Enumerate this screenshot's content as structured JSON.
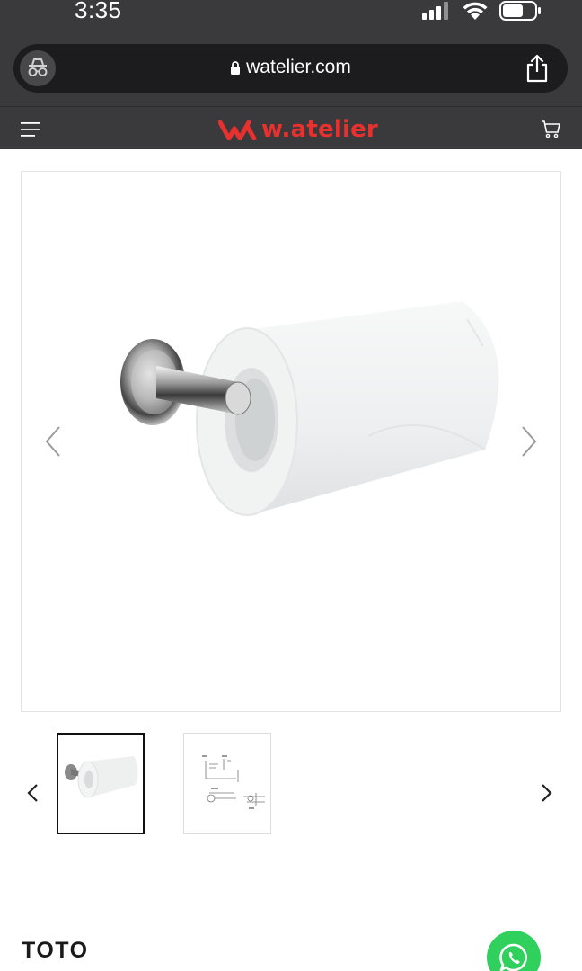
{
  "status_bar": {
    "time": "3:35"
  },
  "browser": {
    "url": "watelier.com",
    "incognito_icon": "incognito-icon",
    "lock_icon": "lock-icon",
    "share_icon": "share-icon"
  },
  "site_header": {
    "menu_icon": "hamburger-menu-icon",
    "logo_text": "w.atelier",
    "cart_icon": "cart-icon",
    "brand_color": "#e8312f",
    "header_bg": "#3a3a3c"
  },
  "gallery": {
    "main_image_alt": "toilet paper holder with roll",
    "prev_icon": "chevron-left-icon",
    "next_icon": "chevron-right-icon",
    "thumbnails": [
      {
        "name": "product-photo",
        "selected": true
      },
      {
        "name": "technical-drawing",
        "selected": false
      }
    ]
  },
  "product": {
    "brand": "TOTO"
  },
  "whatsapp": {
    "icon": "whatsapp-icon",
    "color": "#2fd05c"
  }
}
